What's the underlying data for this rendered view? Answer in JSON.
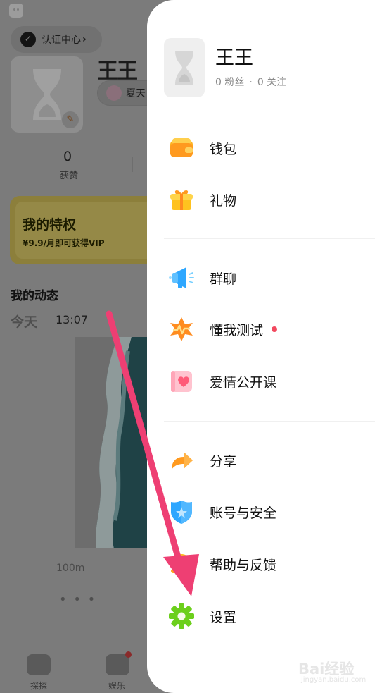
{
  "background": {
    "verify_label": "认证中心",
    "verify_chevron": "›",
    "name": "王王",
    "tag_label": "夏天",
    "stat_value": "0",
    "stat_label": "获赞",
    "vip_title": "我的特权",
    "vip_subtitle": "¥9.9/月即可获得VIP",
    "dynamics_title": "我的动态",
    "today_label": "今天",
    "post_time": "13:07",
    "post_distance": "100m",
    "more_label": "• • •",
    "tabs": [
      {
        "label": "探探",
        "icon": "explore-icon"
      },
      {
        "label": "娱乐",
        "icon": "play-icon"
      }
    ]
  },
  "drawer": {
    "user_name": "王王",
    "fans": "0 粉丝",
    "dot": "·",
    "following": "0 关注",
    "menu": [
      {
        "label": "钱包",
        "icon": "wallet-icon"
      },
      {
        "label": "礼物",
        "icon": "gift-icon"
      },
      {
        "label": "群聊",
        "icon": "megaphone-icon"
      },
      {
        "label": "懂我测试",
        "icon": "test-star-icon",
        "has_dot": true
      },
      {
        "label": "爱情公开课",
        "icon": "heart-book-icon"
      },
      {
        "label": "分享",
        "icon": "share-arrow-icon"
      },
      {
        "label": "账号与安全",
        "icon": "shield-icon"
      },
      {
        "label": "帮助与反馈",
        "icon": "help-bubble-icon"
      },
      {
        "label": "设置",
        "icon": "gear-icon"
      }
    ]
  },
  "colors": {
    "accent_red": "#f2495f",
    "annotation_arrow": "#ee3f73",
    "gear_green": "#6ccf1c",
    "orange": "#ff9a1f",
    "blue": "#2ea7ff"
  },
  "watermark": {
    "brand": "Bai经验",
    "sub": "jingyan.baidu.com"
  }
}
